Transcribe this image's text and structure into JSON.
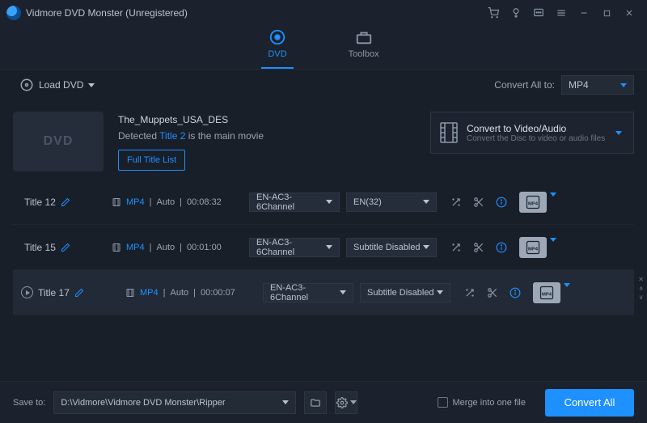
{
  "titlebar": {
    "title": "Vidmore DVD Monster (Unregistered)"
  },
  "tabs": {
    "dvd": "DVD",
    "toolbox": "Toolbox"
  },
  "toolbar": {
    "load_dvd": "Load DVD",
    "convert_all_to_label": "Convert All to:",
    "convert_all_to_value": "MP4"
  },
  "info": {
    "disc_name": "The_Muppets_USA_DES",
    "detected_pre": "Detected ",
    "detected_title": "Title 2",
    "detected_post": " is the main movie",
    "full_title_list": "Full Title List",
    "convert_box_line1": "Convert to Video/Audio",
    "convert_box_line2": "Convert the Disc to video or audio files",
    "thumb_text": "DVD"
  },
  "rows": [
    {
      "title": "Title 12",
      "format": "MP4",
      "quality": "Auto",
      "duration": "00:08:32",
      "audio": "EN-AC3-6Channel",
      "subtitle": "EN(32)",
      "out": "MP4",
      "selected": false
    },
    {
      "title": "Title 15",
      "format": "MP4",
      "quality": "Auto",
      "duration": "00:01:00",
      "audio": "EN-AC3-6Channel",
      "subtitle": "Subtitle Disabled",
      "out": "MP4",
      "selected": false
    },
    {
      "title": "Title 17",
      "format": "MP4",
      "quality": "Auto",
      "duration": "00:00:07",
      "audio": "EN-AC3-6Channel",
      "subtitle": "Subtitle Disabled",
      "out": "MP4",
      "selected": true
    }
  ],
  "footer": {
    "save_to_label": "Save to:",
    "save_to_path": "D:\\Vidmore\\Vidmore DVD Monster\\Ripper",
    "merge_label": "Merge into one file",
    "convert_all_btn": "Convert All"
  }
}
